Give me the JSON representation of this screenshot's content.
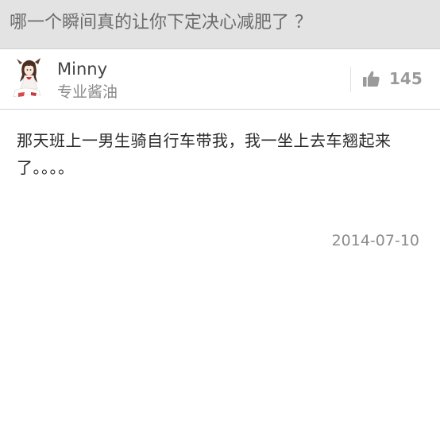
{
  "question": {
    "title": "哪一个瞬间真的让你下定决心减肥了 ？"
  },
  "author": {
    "name": "Minny",
    "signature": "专业酱油",
    "avatar_icon": "anime-girl-avatar"
  },
  "votes": {
    "icon": "thumb-up-icon",
    "count": "145"
  },
  "answer": {
    "content": "那天班上一男生骑自行车带我，我一坐上去车翘起来了。。。。",
    "date": "2014-07-10"
  },
  "colors": {
    "question_bar_bg": "#e3e3e3",
    "question_text": "#6b6b6b",
    "vote_gray": "#9a9a9a",
    "body_text": "#2a2a2a",
    "date_text": "#8c8c8c"
  }
}
